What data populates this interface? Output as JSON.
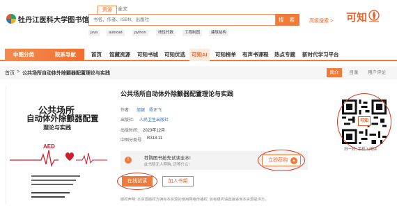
{
  "header": {
    "library_name": "牡丹江医科大学图书馆",
    "search_tabs": [
      "资源",
      "全文"
    ],
    "search_placeholder": "书名、作者、ISBN、出版社",
    "search_button": "搜 索",
    "advanced_search": "高级搜索 >",
    "brand": "可知",
    "keywords": [
      "java",
      "autocad",
      "python",
      "线性代数",
      "工程制图",
      "建筑结构"
    ]
  },
  "nav": {
    "left_items": [
      "中图分类",
      "院系导航"
    ],
    "items": [
      "首页",
      "馆藏资源",
      "可知书城",
      "可知优选",
      "可知AI",
      "可知榜单",
      "有声书课程",
      "热点专题",
      "新时代学习平台"
    ]
  },
  "breadcrumb": {
    "home": "首页",
    "separator": ">",
    "current": "公共场所自动体外除颤器配置理论与实践"
  },
  "right_tabs": [
    "简介",
    "目录",
    "用户评论"
  ],
  "cover": {
    "title_line1": "公共场所",
    "title_line2": "自动体外除颤器配置",
    "title_line3": "理论与实践",
    "aed_text": "AED"
  },
  "book": {
    "title": "公共场所自动体外除颤器配置理论与实践",
    "author_label": "作者:",
    "authors": [
      "旭银",
      "杨正飞"
    ],
    "publisher_label": "出版社:",
    "publisher": "人民卫生出版社",
    "pubdate_label": "出版时间:",
    "pubdate": "2023年12月",
    "class_label": "中图分类号:",
    "class_no": "R318.11"
  },
  "try_read": {
    "line1": "荐购图书抢先试读全本!",
    "line2": "此书暂无人荐购, 还等什么!",
    "store_button": "立即荐购"
  },
  "actions": {
    "read_online": "在线试读",
    "add_shelf": "加入书架"
  },
  "notice": "版权声明: 本资源版权方拥有本资源的使用网络传播权, 如有疑问请直接咨询本资源提供方。",
  "qr": {
    "center_text": "可知",
    "caption": "扫一扫, 手机上阅读"
  },
  "colors": {
    "accent": "#f07a3a",
    "link": "#2f6fbf",
    "aed_red": "#d21e2a"
  }
}
